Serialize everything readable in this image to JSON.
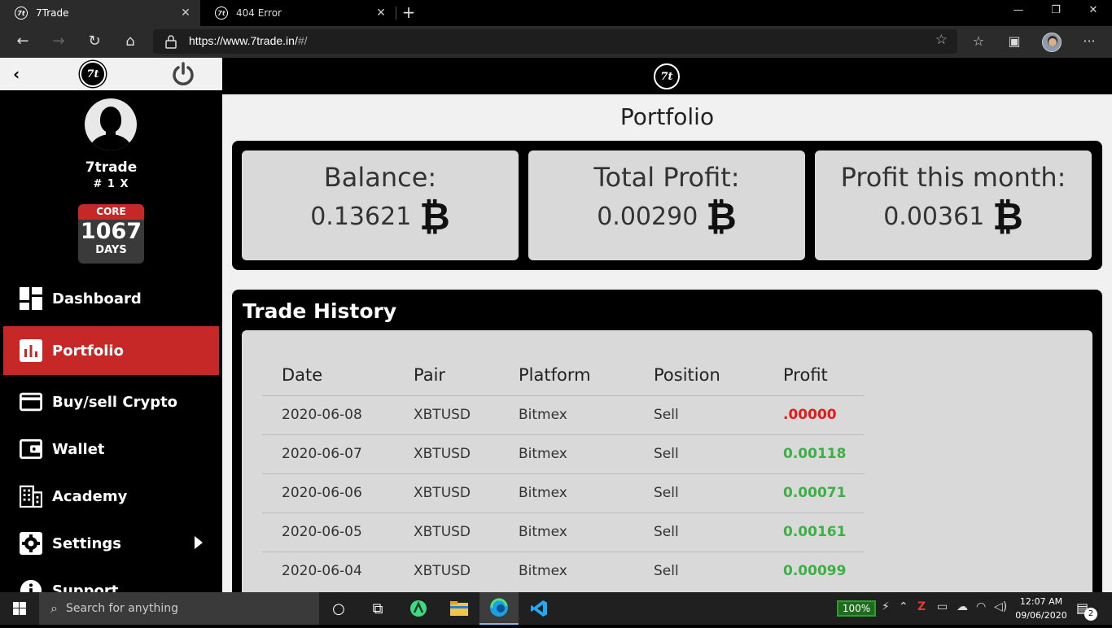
{
  "browser": {
    "tabs": [
      {
        "title": "7Trade",
        "active": true
      },
      {
        "title": "404 Error",
        "active": false
      }
    ],
    "url_host": "https://www.7trade.in/",
    "url_path": "#/"
  },
  "sidebar": {
    "username": "7trade",
    "rank": "# 1 X",
    "core_label": "CORE",
    "core_days_value": "1067",
    "core_days_label": "DAYS",
    "logo_text": "7t",
    "items": [
      {
        "label": "Dashboard",
        "icon": "dashboard-icon",
        "active": false
      },
      {
        "label": "Portfolio",
        "icon": "chart-icon",
        "active": true
      },
      {
        "label": "Buy/sell Crypto",
        "icon": "card-icon",
        "active": false
      },
      {
        "label": "Wallet",
        "icon": "wallet-icon",
        "active": false
      },
      {
        "label": "Academy",
        "icon": "building-icon",
        "active": false
      },
      {
        "label": "Settings",
        "icon": "gear-icon",
        "active": false
      },
      {
        "label": "Support",
        "icon": "info-icon",
        "active": false
      }
    ]
  },
  "main": {
    "title": "Portfolio",
    "stats": [
      {
        "label": "Balance:",
        "value": "0.13621"
      },
      {
        "label": "Total Profit:",
        "value": "0.00290"
      },
      {
        "label": "Profit this month:",
        "value": "0.00361"
      }
    ],
    "btc_symbol": "₿",
    "history_title": "Trade History",
    "columns": [
      "Date",
      "Pair",
      "Platform",
      "Position",
      "Profit"
    ],
    "rows": [
      {
        "date": "2020-06-08",
        "pair": "XBTUSD",
        "platform": "Bitmex",
        "position": "Sell",
        "profit": ".00000",
        "color": "#e31b1b"
      },
      {
        "date": "2020-06-07",
        "pair": "XBTUSD",
        "platform": "Bitmex",
        "position": "Sell",
        "profit": "0.00118",
        "color": "#3cb043"
      },
      {
        "date": "2020-06-06",
        "pair": "XBTUSD",
        "platform": "Bitmex",
        "position": "Sell",
        "profit": "0.00071",
        "color": "#3cb043"
      },
      {
        "date": "2020-06-05",
        "pair": "XBTUSD",
        "platform": "Bitmex",
        "position": "Sell",
        "profit": "0.00161",
        "color": "#3cb043"
      },
      {
        "date": "2020-06-04",
        "pair": "XBTUSD",
        "platform": "Bitmex",
        "position": "Sell",
        "profit": "0.00099",
        "color": "#3cb043"
      }
    ]
  },
  "taskbar": {
    "search_placeholder": "Search for anything",
    "battery": "100%",
    "time": "12:07 AM",
    "date": "09/06/2020",
    "notifications": "2"
  },
  "colors": {
    "accent_red": "#c62828",
    "profit_positive": "#3cb043",
    "profit_zero": "#e31b1b"
  }
}
